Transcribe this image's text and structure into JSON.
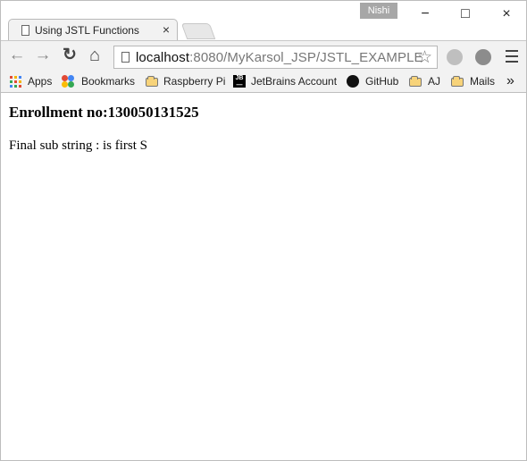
{
  "window": {
    "profile_name": "Nishi",
    "controls": [
      "minimize",
      "maximize",
      "close"
    ]
  },
  "tab": {
    "title": "Using JSTL Functions",
    "close_label": "×"
  },
  "toolbar": {
    "url_host": "localhost",
    "url_rest": ":8080/MyKarsol_JSP/JSTL_EXAMPLE",
    "buttons": [
      "back-icon",
      "forward-icon",
      "reload-icon",
      "home-icon",
      "star-icon",
      "menu-icon"
    ],
    "glyphs": {
      "back": "←",
      "forward": "→",
      "reload": "↻",
      "home": "⌂",
      "star": "☆",
      "minimize": "−",
      "maximize": "□",
      "close": "×"
    }
  },
  "bookmarks": {
    "items": [
      "Apps",
      "Bookmarks",
      "Raspberry Pi",
      "JetBrains Account",
      "GitHub",
      "AJ",
      "Mails"
    ],
    "more": "»"
  },
  "content": {
    "heading": "Enrollment no:130050131525",
    "line": "Final sub string : is first S"
  },
  "colors": {
    "browser_chrome": "#f2f2f2",
    "profile_badge": "#a7a7a7",
    "folder": "#f7d37a"
  }
}
